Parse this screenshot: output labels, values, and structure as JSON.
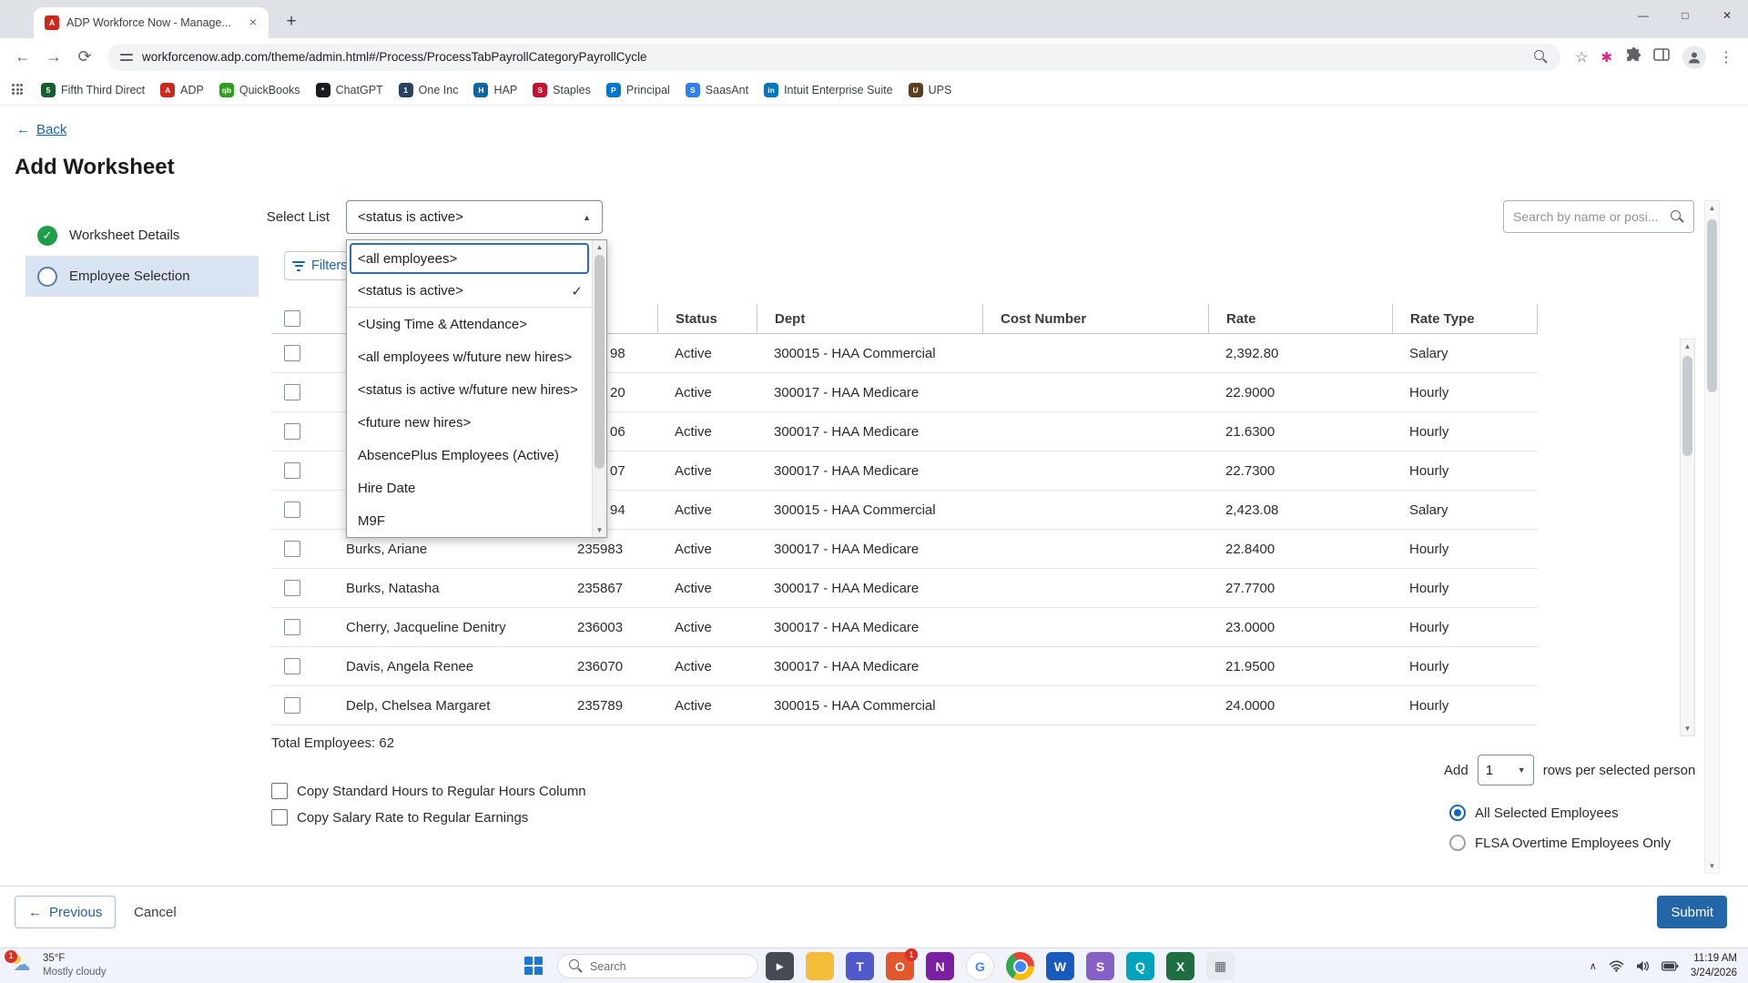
{
  "theme": {
    "accent": "#2566a8",
    "link": "#1766b3",
    "success": "#1e9e4a",
    "focus": "#2b6bc4",
    "step-bg": "#d9e4f2"
  },
  "glyphs": {
    "back": "←",
    "forward": "→",
    "reload": "⟳",
    "up": "▲",
    "down": "▼",
    "check": "✓",
    "close": "×",
    "plus": "+",
    "minimize": "—",
    "maximize": "□",
    "win_close": "✕",
    "kebab": "⋮",
    "star": "☆",
    "pink_ext": "✱",
    "caret_open": "▲",
    "caret_down": "▼",
    "chevron_up": "∧",
    "cloud": "☁",
    "favicon_letter": "A"
  },
  "browser": {
    "tab_title": "ADP Workforce Now - Manage...",
    "url": "workforcenow.adp.com/theme/admin.html#/Process/ProcessTabPayrollCategoryPayrollCycle",
    "bookmarks": [
      {
        "name": "bookmark-fifth-third-direct",
        "label": "Fifth Third Direct",
        "color": "#175e2e",
        "glyph": "5"
      },
      {
        "name": "bookmark-adp",
        "label": "ADP",
        "color": "#d0271d",
        "glyph": "A"
      },
      {
        "name": "bookmark-quickbooks",
        "label": "QuickBooks",
        "color": "#2ca01c",
        "glyph": "qb"
      },
      {
        "name": "bookmark-chatgpt",
        "label": "ChatGPT",
        "color": "#1b1b1f",
        "glyph": "*"
      },
      {
        "name": "bookmark-one-inc",
        "label": "One Inc",
        "color": "#29415e",
        "glyph": "1"
      },
      {
        "name": "bookmark-hap",
        "label": "HAP",
        "color": "#0a66a5",
        "glyph": "H"
      },
      {
        "name": "bookmark-staples",
        "label": "Staples",
        "color": "#c8102e",
        "glyph": "S"
      },
      {
        "name": "bookmark-principal",
        "label": "Principal",
        "color": "#0076cf",
        "glyph": "P"
      },
      {
        "name": "bookmark-saasant",
        "label": "SaasAnt",
        "color": "#2f80ed",
        "glyph": "S"
      },
      {
        "name": "bookmark-intuit-enterprise-suite",
        "label": "Intuit Enterprise Suite",
        "color": "#0077c5",
        "glyph": "in"
      },
      {
        "name": "bookmark-ups",
        "label": "UPS",
        "color": "#5a3c1e",
        "glyph": "U"
      }
    ]
  },
  "page": {
    "back_label": "Back",
    "title": "Add Worksheet",
    "steps": [
      {
        "label": "Worksheet Details",
        "state": "complete",
        "complete": true
      },
      {
        "label": "Employee Selection",
        "state": "active",
        "active": true
      }
    ],
    "select_list_label": "Select List",
    "select_list_value": "<status is active>",
    "dropdown_options": [
      {
        "label": "<all employees>",
        "focused": true
      },
      {
        "label": "<status is active>",
        "checked": true
      },
      {
        "label": "<Using Time & Attendance>"
      },
      {
        "label": "<all employees w/future new hires>"
      },
      {
        "label": "<status is active w/future new hires>"
      },
      {
        "label": "<future new hires>"
      },
      {
        "label": "AbsencePlus Employees (Active)"
      },
      {
        "label": "Hire Date"
      },
      {
        "label": "M9F"
      }
    ],
    "search_placeholder": "Search by name or posi...",
    "filters_label": "Filters",
    "table": {
      "headers": {
        "status": "Status",
        "dept": "Dept",
        "cost": "Cost Number",
        "rate": "Rate",
        "rate_type": "Rate Type"
      },
      "rows": [
        {
          "name": "",
          "id": "98",
          "status": "Active",
          "dept": "300015 - HAA Commercial",
          "cost": "",
          "rate": "2,392.80",
          "rate_type": "Salary"
        },
        {
          "name": "",
          "id": "20",
          "status": "Active",
          "dept": "300017 - HAA Medicare",
          "cost": "",
          "rate": "22.9000",
          "rate_type": "Hourly"
        },
        {
          "name": "",
          "id": "06",
          "status": "Active",
          "dept": "300017 - HAA Medicare",
          "cost": "",
          "rate": "21.6300",
          "rate_type": "Hourly"
        },
        {
          "name": "",
          "id": "07",
          "status": "Active",
          "dept": "300017 - HAA Medicare",
          "cost": "",
          "rate": "22.7300",
          "rate_type": "Hourly"
        },
        {
          "name": "",
          "id": "94",
          "status": "Active",
          "dept": "300015 - HAA Commercial",
          "cost": "",
          "rate": "2,423.08",
          "rate_type": "Salary"
        },
        {
          "name": "Burks, Ariane",
          "id": "235983",
          "status": "Active",
          "dept": "300017 - HAA Medicare",
          "cost": "",
          "rate": "22.8400",
          "rate_type": "Hourly"
        },
        {
          "name": "Burks, Natasha",
          "id": "235867",
          "status": "Active",
          "dept": "300017 - HAA Medicare",
          "cost": "",
          "rate": "27.7700",
          "rate_type": "Hourly"
        },
        {
          "name": "Cherry, Jacqueline Denitry",
          "id": "236003",
          "status": "Active",
          "dept": "300017 - HAA Medicare",
          "cost": "",
          "rate": "23.0000",
          "rate_type": "Hourly"
        },
        {
          "name": "Davis, Angela Renee",
          "id": "236070",
          "status": "Active",
          "dept": "300017 - HAA Medicare",
          "cost": "",
          "rate": "21.9500",
          "rate_type": "Hourly"
        },
        {
          "name": "Delp, Chelsea Margaret",
          "id": "235789",
          "status": "Active",
          "dept": "300015 - HAA Commercial",
          "cost": "",
          "rate": "24.0000",
          "rate_type": "Hourly"
        }
      ]
    },
    "total_label": "Total Employees: 62",
    "copy_options": [
      {
        "label": "Copy Standard Hours to Regular Hours Column"
      },
      {
        "label": "Copy Salary Rate to Regular Earnings"
      }
    ],
    "add_rows": {
      "prefix": "Add",
      "value": "1",
      "suffix": "rows per selected person"
    },
    "radio_options": [
      {
        "label": "All Selected Employees",
        "checked": true
      },
      {
        "label": "FLSA Overtime Employees Only"
      }
    ],
    "previous_label": "Previous",
    "cancel_label": "Cancel",
    "submit_label": "Submit"
  },
  "taskbar": {
    "weather_temp": "35°F",
    "weather_desc": "Mostly cloudy",
    "weather_badge": "1",
    "search_placeholder": "Search",
    "apps": [
      {
        "name": "terminal",
        "color": "#454a54",
        "glyph": "▸"
      },
      {
        "name": "file-explorer",
        "color": "#f3bd3a",
        "glyph": ""
      },
      {
        "name": "teams",
        "color": "#5059c9",
        "glyph": "T"
      },
      {
        "name": "outlook",
        "color": "#e2572b",
        "glyph": "O",
        "badge": "1"
      },
      {
        "name": "onenote",
        "color": "#7a1fa2",
        "glyph": "N"
      },
      {
        "name": "google-g",
        "color": "#ffffff",
        "glyph": "G",
        "light": true,
        "round": true
      },
      {
        "name": "chrome",
        "color": "conic-gradient(from -30deg, #ea4335 0 120deg, #fbbc05 120deg 240deg, #34a853 240deg 360deg)",
        "glyph": "",
        "chrome": true,
        "round": true
      },
      {
        "name": "word",
        "color": "#185abd",
        "glyph": "W"
      },
      {
        "name": "stream",
        "color": "#8661c5",
        "glyph": "S"
      },
      {
        "name": "quickbooks",
        "color": "#00a4bd",
        "glyph": "Q"
      },
      {
        "name": "excel",
        "color": "#1d6f42",
        "glyph": "X"
      },
      {
        "name": "sheets-grid",
        "color": "#e7ebf0",
        "glyph": "▦",
        "dark": true
      }
    ],
    "time": "11:19 AM",
    "date": "3/24/2026"
  }
}
